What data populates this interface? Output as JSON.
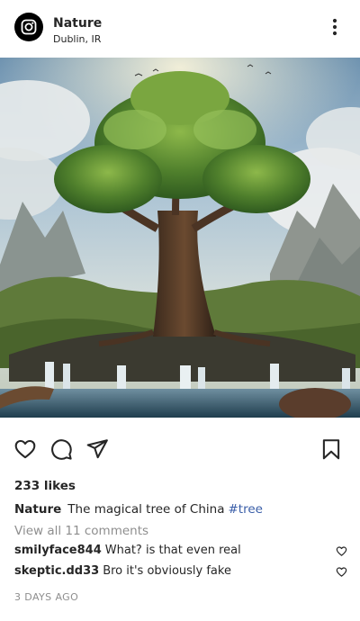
{
  "post": {
    "username": "Nature",
    "location": "Dublin, IR",
    "avatar_icon": "instagram-logo-icon",
    "likes": "233 likes",
    "caption": {
      "username": "Nature",
      "text": "The magical tree of China",
      "hashtag": "#tree"
    },
    "view_all_comments": "View all 11 comments",
    "comments": [
      {
        "username": "smilyface844",
        "text": "What? is that even real"
      },
      {
        "username": "skeptic.dd33",
        "text": "Bro it's obviously fake"
      }
    ],
    "timestamp": "3 DAYS AGO"
  },
  "icons": {
    "more": "more-vertical-icon",
    "like": "heart-icon",
    "comment": "comment-bubble-icon",
    "share": "paper-plane-icon",
    "save": "bookmark-icon",
    "comment_like": "small-heart-icon"
  },
  "colors": {
    "hashtag": "#3a5ea8",
    "muted": "#8e8e8e",
    "text": "#262626"
  }
}
